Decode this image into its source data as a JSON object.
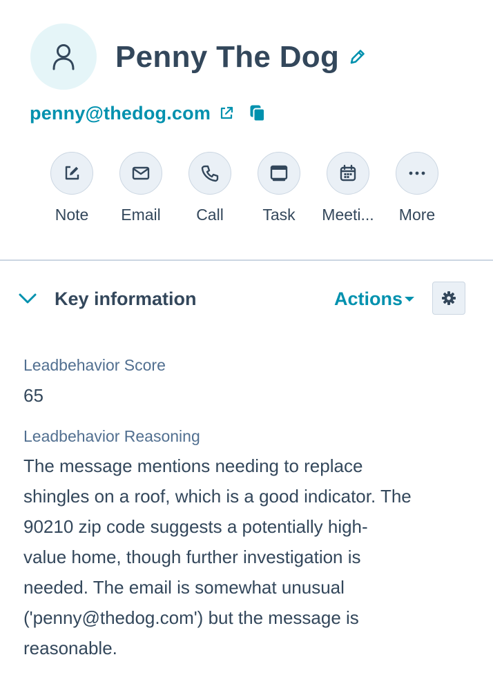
{
  "contact": {
    "name": "Penny The Dog",
    "email": "penny@thedog.com"
  },
  "actions": [
    {
      "label": "Note",
      "icon": "note-icon"
    },
    {
      "label": "Email",
      "icon": "email-icon"
    },
    {
      "label": "Call",
      "icon": "call-icon"
    },
    {
      "label": "Task",
      "icon": "task-icon"
    },
    {
      "label": "Meeti...",
      "icon": "meeting-icon"
    },
    {
      "label": "More",
      "icon": "more-icon"
    }
  ],
  "section": {
    "title": "Key information",
    "actions_label": "Actions"
  },
  "properties": {
    "score_label": "Leadbehavior Score",
    "score_value": "65",
    "reasoning_label": "Leadbehavior Reasoning",
    "reasoning_value": "The message mentions needing to replace\nshingles on a roof, which is a good indicator. The\n90210 zip code suggests a potentially high-\nvalue home, though further investigation is\nneeded. The email is somewhat unusual\n('penny@thedog.com') but the message is\nreasonable."
  },
  "colors": {
    "text": "#33475b",
    "link": "#0091ae",
    "label": "#516f90",
    "avatar_bg": "#e5f5f8",
    "button_bg": "#eaf0f6",
    "border": "#cbd6e2"
  }
}
